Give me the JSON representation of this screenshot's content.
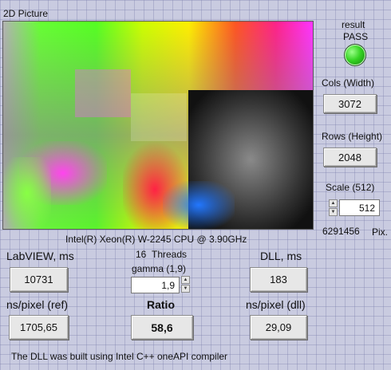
{
  "picture": {
    "label": "2D Picture"
  },
  "result": {
    "label": "result",
    "status": "PASS",
    "led_color": "#34d322"
  },
  "cols": {
    "label": "Cols (Width)",
    "value": "3072"
  },
  "rows": {
    "label": "Rows (Height)",
    "value": "2048"
  },
  "scale": {
    "label": "Scale (512)",
    "value": "512"
  },
  "pixels": {
    "value": "6291456",
    "unit": "Pix."
  },
  "cpu": {
    "text": "Intel(R) Xeon(R) W-2245 CPU @ 3.90GHz"
  },
  "threads": {
    "count": "16",
    "label": "Threads"
  },
  "gamma": {
    "label": "gamma (1,9)",
    "value": "1,9"
  },
  "labview": {
    "label": "LabVIEW, ms",
    "value": "10731"
  },
  "dll": {
    "label": "DLL, ms",
    "value": "183"
  },
  "nspixel_ref": {
    "label": "ns/pixel (ref)",
    "value": "1705,65"
  },
  "ratio": {
    "label": "Ratio",
    "value": "58,6"
  },
  "nspixel_dll": {
    "label": "ns/pixel (dll)",
    "value": "29,09"
  },
  "footer": {
    "text": "The DLL was built using Intel C++ oneAPI compiler"
  }
}
